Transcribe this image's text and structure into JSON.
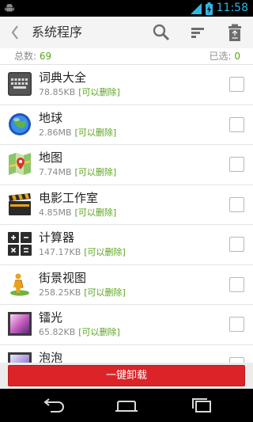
{
  "status_bar": {
    "time": "11:58",
    "color": "#33b5e5"
  },
  "header": {
    "title": "系统程序",
    "back_icon": "chevron-left-icon",
    "actions": [
      "search-icon",
      "sort-icon",
      "trash-icon"
    ]
  },
  "counts": {
    "total_label": "总数:",
    "total_value": "69",
    "selected_label": "已选:",
    "selected_value": "0"
  },
  "apps": [
    {
      "name": "词典大全",
      "size": "78.85KB",
      "tag": "[可以删除]",
      "icon": "keyboard-icon"
    },
    {
      "name": "地球",
      "size": "2.86MB",
      "tag": "[可以删除]",
      "icon": "globe-icon"
    },
    {
      "name": "地图",
      "size": "7.74MB",
      "tag": "[可以删除]",
      "icon": "map-icon"
    },
    {
      "name": "电影工作室",
      "size": "4.85MB",
      "tag": "[可以删除]",
      "icon": "clapperboard-icon"
    },
    {
      "name": "计算器",
      "size": "147.17KB",
      "tag": "[可以删除]",
      "icon": "calculator-icon"
    },
    {
      "name": "街景视图",
      "size": "258.25KB",
      "tag": "[可以删除]",
      "icon": "street-view-icon"
    },
    {
      "name": "镭光",
      "size": "65.82KB",
      "tag": "[可以删除]",
      "icon": "photo-frame-icon"
    },
    {
      "name": "泡泡",
      "size": "",
      "tag": "",
      "icon": "photo-frame-icon"
    }
  ],
  "uninstall_label": "一键卸载",
  "colors": {
    "accent_green": "#5aa51e",
    "uninstall_red": "#dc2428"
  },
  "nav": [
    "back-icon",
    "home-icon",
    "recents-icon"
  ]
}
